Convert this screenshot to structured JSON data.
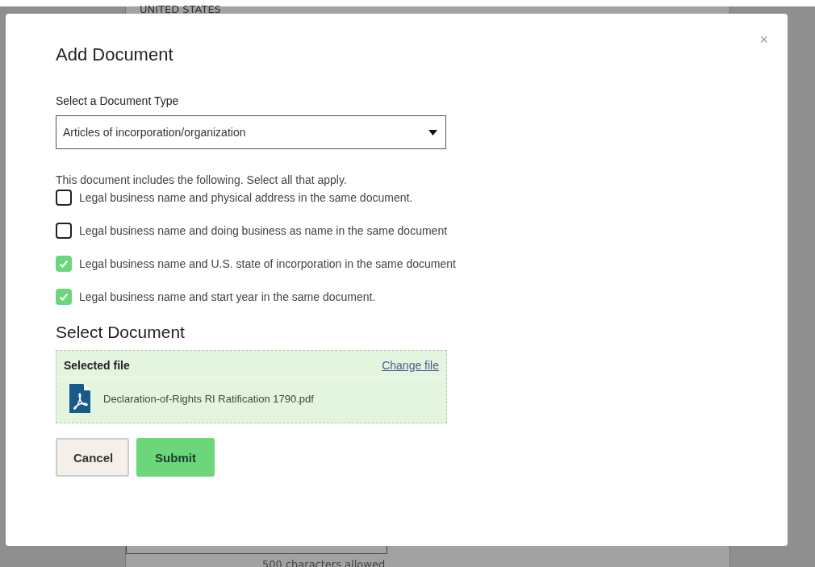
{
  "background_page": {
    "country": "UNITED STATES",
    "char_limit_note": "500 characters allowed"
  },
  "dialog": {
    "title": "Add Document",
    "close": "×",
    "document_type": {
      "label": "Select a Document Type",
      "value": "Articles of incorporation/organization"
    },
    "includes_prompt": "This document includes the following. Select all that apply.",
    "options": [
      {
        "label": "Legal business name and physical address in the same document.",
        "checked": false
      },
      {
        "label": "Legal business name and doing business as name in the same document",
        "checked": false
      },
      {
        "label": "Legal business name and U.S. state of incorporation in the same document",
        "checked": true
      },
      {
        "label": "Legal business name and start year in the same document.",
        "checked": true
      }
    ],
    "select_document": {
      "heading": "Select Document",
      "selected_label": "Selected file",
      "change_link": "Change file",
      "file_name": "Declaration-of-Rights RI Ratification 1790.pdf"
    },
    "buttons": [
      {
        "label": "Cancel",
        "kind": "secondary"
      },
      {
        "label": "Submit",
        "kind": "primary"
      }
    ]
  }
}
